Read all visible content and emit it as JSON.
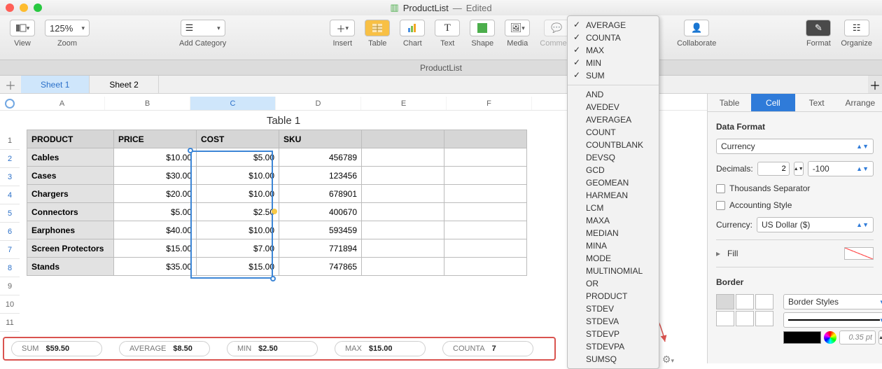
{
  "window": {
    "filename": "ProductList",
    "status": "Edited",
    "doc_tab": "ProductList"
  },
  "toolbar": {
    "view": "View",
    "zoom": "Zoom",
    "zoom_value": "125%",
    "addcat": "Add Category",
    "insert": "Insert",
    "table": "Table",
    "chart": "Chart",
    "text": "Text",
    "shape": "Shape",
    "media": "Media",
    "comment": "Comment",
    "collaborate": "Collaborate",
    "format": "Format",
    "organize": "Organize"
  },
  "sheets": {
    "s1": "Sheet 1",
    "s2": "Sheet 2"
  },
  "columns": [
    "A",
    "B",
    "C",
    "D",
    "E",
    "F"
  ],
  "table": {
    "title": "Table 1",
    "headers": {
      "product": "PRODUCT",
      "price": "PRICE",
      "cost": "COST",
      "sku": "SKU"
    },
    "rows": [
      {
        "product": "Cables",
        "price": "$10.00",
        "cost": "$5.00",
        "sku": "456789"
      },
      {
        "product": "Cases",
        "price": "$30.00",
        "cost": "$10.00",
        "sku": "123456"
      },
      {
        "product": "Chargers",
        "price": "$20.00",
        "cost": "$10.00",
        "sku": "678901"
      },
      {
        "product": "Connectors",
        "price": "$5.00",
        "cost": "$2.50",
        "sku": "400670"
      },
      {
        "product": "Earphones",
        "price": "$40.00",
        "cost": "$10.00",
        "sku": "593459"
      },
      {
        "product": "Screen Protectors",
        "price": "$15.00",
        "cost": "$7.00",
        "sku": "771894"
      },
      {
        "product": "Stands",
        "price": "$35.00",
        "cost": "$15.00",
        "sku": "747865"
      }
    ]
  },
  "stats": {
    "sum": {
      "label": "SUM",
      "value": "$59.50"
    },
    "avg": {
      "label": "AVERAGE",
      "value": "$8.50"
    },
    "min": {
      "label": "MIN",
      "value": "$2.50"
    },
    "max": {
      "label": "MAX",
      "value": "$15.00"
    },
    "counta": {
      "label": "COUNTA",
      "value": "7"
    }
  },
  "func_menu": {
    "checked": [
      "AVERAGE",
      "COUNTA",
      "MAX",
      "MIN",
      "SUM"
    ],
    "others": [
      "AND",
      "AVEDEV",
      "AVERAGEA",
      "COUNT",
      "COUNTBLANK",
      "DEVSQ",
      "GCD",
      "GEOMEAN",
      "HARMEAN",
      "LCM",
      "MAXA",
      "MEDIAN",
      "MINA",
      "MODE",
      "MULTINOMIAL",
      "OR",
      "PRODUCT",
      "STDEV",
      "STDEVA",
      "STDEVP",
      "STDEVPA",
      "SUMSQ"
    ]
  },
  "inspector": {
    "tabs": {
      "table": "Table",
      "cell": "Cell",
      "text": "Text",
      "arrange": "Arrange"
    },
    "dataformat": {
      "heading": "Data Format",
      "format": "Currency",
      "decimals_label": "Decimals:",
      "decimals": "2",
      "neg": "-100",
      "thousands": "Thousands Separator",
      "accounting": "Accounting Style",
      "currency_label": "Currency:",
      "currency": "US Dollar ($)"
    },
    "fill": "Fill",
    "border": {
      "heading": "Border",
      "styles": "Border Styles",
      "size": "0.35 pt"
    }
  }
}
